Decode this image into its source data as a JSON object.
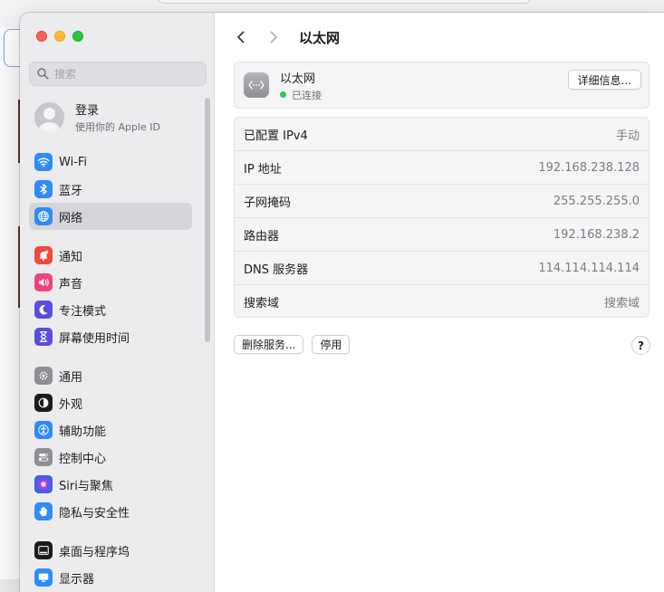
{
  "sidebar": {
    "search": {
      "placeholder": "搜索"
    },
    "account": {
      "title": "登录",
      "subtitle": "使用你的 Apple ID"
    },
    "items_group1": [
      {
        "label": "Wi-Fi",
        "icon": "wifi-icon",
        "color": "#2f8cf7"
      },
      {
        "label": "蓝牙",
        "icon": "bluetooth-icon",
        "color": "#2f8cf7"
      },
      {
        "label": "网络",
        "icon": "globe-icon",
        "color": "#2f8cf7",
        "active": true
      }
    ],
    "items_group2": [
      {
        "label": "通知",
        "icon": "bell-icon",
        "color": "#f04a3c"
      },
      {
        "label": "声音",
        "icon": "speaker-icon",
        "color": "#f0457a"
      },
      {
        "label": "专注模式",
        "icon": "moon-icon",
        "color": "#5b4ede"
      },
      {
        "label": "屏幕使用时间",
        "icon": "hourglass-icon",
        "color": "#5b4ede"
      }
    ],
    "items_group3": [
      {
        "label": "通用",
        "icon": "gear-icon",
        "color": "#8e8e93"
      },
      {
        "label": "外观",
        "icon": "appearance-icon",
        "color": "#1c1c1e"
      },
      {
        "label": "辅助功能",
        "icon": "accessibility-icon",
        "color": "#2f8cf7"
      },
      {
        "label": "控制中心",
        "icon": "switches-icon",
        "color": "#8e8e93"
      },
      {
        "label": "Siri与聚焦",
        "icon": "siri-icon",
        "color": "#222"
      },
      {
        "label": "隐私与安全性",
        "icon": "hand-icon",
        "color": "#2f8cf7"
      }
    ],
    "items_group4": [
      {
        "label": "桌面与程序坞",
        "icon": "dock-icon",
        "color": "#1c1c1e"
      },
      {
        "label": "显示器",
        "icon": "display-icon",
        "color": "#2f8cf7"
      }
    ]
  },
  "header": {
    "title": "以太网"
  },
  "service": {
    "name": "以太网",
    "status": "已连接",
    "status_color": "#30c74c",
    "details_button": "详细信息..."
  },
  "info_rows": [
    {
      "key": "已配置 IPv4",
      "value": "手动"
    },
    {
      "key": "IP 地址",
      "value": "192.168.238.128"
    },
    {
      "key": "子网掩码",
      "value": "255.255.255.0"
    },
    {
      "key": "路由器",
      "value": "192.168.238.2"
    },
    {
      "key": "DNS 服务器",
      "value": "114.114.114.114"
    },
    {
      "key": "搜索域",
      "value": "搜索域"
    }
  ],
  "actions": {
    "delete_service": "删除服务...",
    "disable": "停用",
    "help": "?"
  }
}
